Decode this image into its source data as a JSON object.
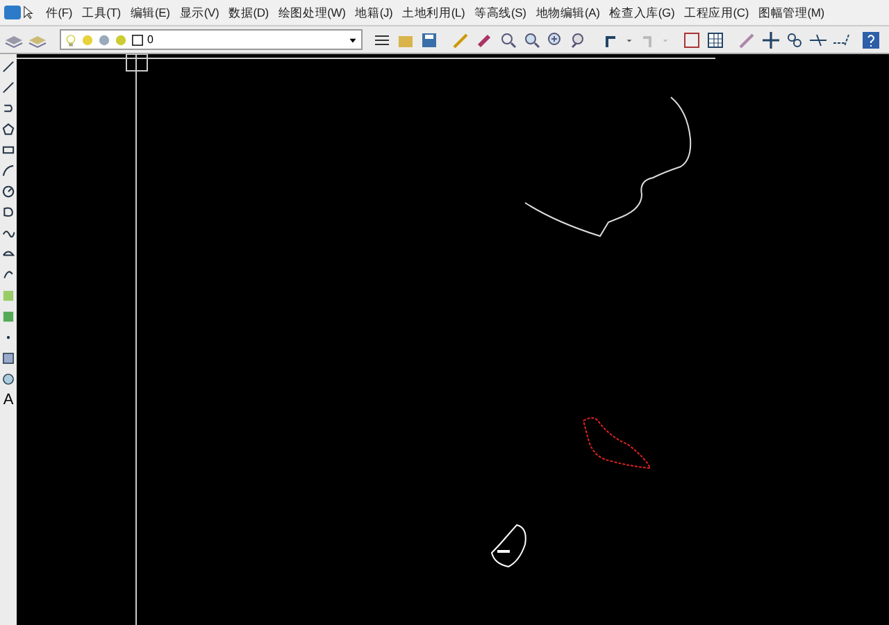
{
  "menu": [
    {
      "label": "件(F)"
    },
    {
      "label": "工具(T)"
    },
    {
      "label": "编辑(E)"
    },
    {
      "label": "显示(V)"
    },
    {
      "label": "数据(D)"
    },
    {
      "label": "绘图处理(W)"
    },
    {
      "label": "地籍(J)"
    },
    {
      "label": "土地利用(L)"
    },
    {
      "label": "等高线(S)"
    },
    {
      "label": "地物编辑(A)"
    },
    {
      "label": "检查入库(G)"
    },
    {
      "label": "工程应用(C)"
    },
    {
      "label": "图幅管理(M)"
    }
  ],
  "layer_field": {
    "value": "0"
  },
  "side_text_tool": "A"
}
